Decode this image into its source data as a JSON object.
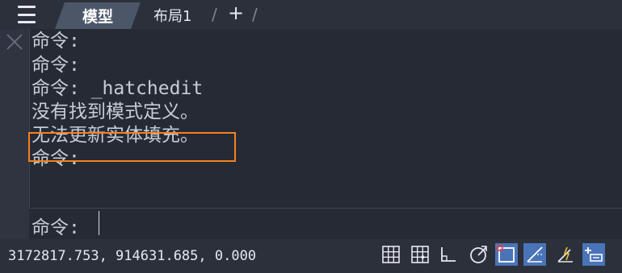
{
  "tabs": {
    "model": "模型",
    "layout1": "布局1",
    "add": "+"
  },
  "command_history": [
    "命令:",
    "命令:",
    "命令: _hatchedit",
    "没有找到模式定义。",
    "无法更新实体填充。",
    "命令:"
  ],
  "command_input": {
    "prompt": "命令:"
  },
  "status": {
    "coordinates": "3172817.753, 914631.685, 0.000",
    "buttons": [
      {
        "icon": "grid-display-icon",
        "active": false
      },
      {
        "icon": "snap-mode-icon",
        "active": false
      },
      {
        "icon": "ortho-mode-icon",
        "active": false
      },
      {
        "icon": "polar-tracking-icon",
        "active": false
      },
      {
        "icon": "object-snap-icon",
        "active": true
      },
      {
        "icon": "object-snap-tracking-icon",
        "active": true
      },
      {
        "icon": "dynamic-ucs-icon",
        "active": false
      },
      {
        "icon": "dynamic-input-icon",
        "active": true
      }
    ]
  },
  "colors": {
    "highlight_border": "#f58220",
    "active_button": "#4a74b8"
  }
}
